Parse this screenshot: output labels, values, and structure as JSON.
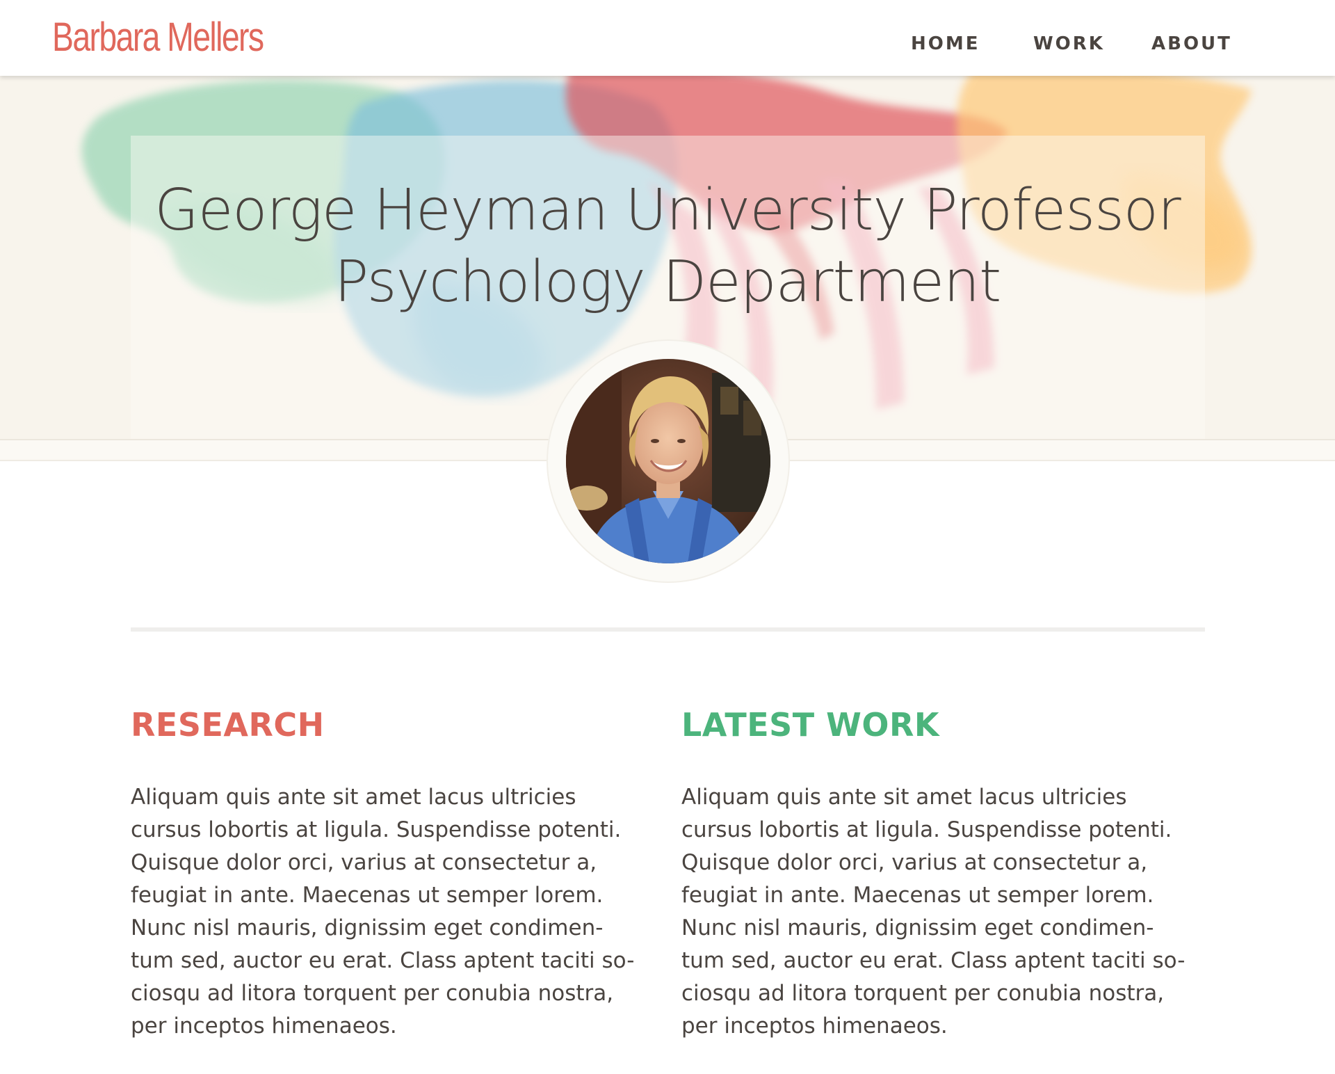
{
  "brand": {
    "name": "Barbara Mellers",
    "color": "#e0685c"
  },
  "nav": {
    "items": [
      {
        "label": "HOME"
      },
      {
        "label": "WORK"
      },
      {
        "label": "ABOUT"
      }
    ]
  },
  "hero": {
    "title_line1": "George Heyman University Professor",
    "title_line2": "Psychology Department",
    "background_color": "#f8f4ec",
    "paint_colors": [
      "#8fd3b0",
      "#7fc0dc",
      "#e0585e",
      "#f08aa0",
      "#ffc978"
    ]
  },
  "profile": {
    "avatar_alt": "Portrait photo"
  },
  "sections": {
    "research": {
      "heading": "RESEARCH",
      "color": "#e0685c",
      "lines": [
        "Aliquam quis ante sit amet lacus ultricies",
        "cursus lobortis at ligula. Suspendisse potenti.",
        "Quisque dolor orci, varius at consectetur a,",
        "feugiat in ante. Maecenas ut semper lorem.",
        "Nunc nisl mauris, dignissim eget condimen-",
        "tum sed, auctor eu erat. Class aptent taciti so-",
        "ciosqu ad litora torquent per conubia nostra,",
        "per inceptos himenaeos."
      ]
    },
    "latest_work": {
      "heading": "LATEST WORK",
      "color": "#4cb47c",
      "lines": [
        "Aliquam quis ante sit amet lacus ultricies",
        "cursus lobortis at ligula. Suspendisse potenti.",
        "Quisque dolor orci, varius at consectetur a,",
        "feugiat in ante. Maecenas ut semper lorem.",
        "Nunc nisl mauris, dignissim eget condimen-",
        "tum sed, auctor eu erat. Class aptent taciti so-",
        "ciosqu ad litora torquent per conubia nostra,",
        "per inceptos himenaeos."
      ]
    }
  }
}
